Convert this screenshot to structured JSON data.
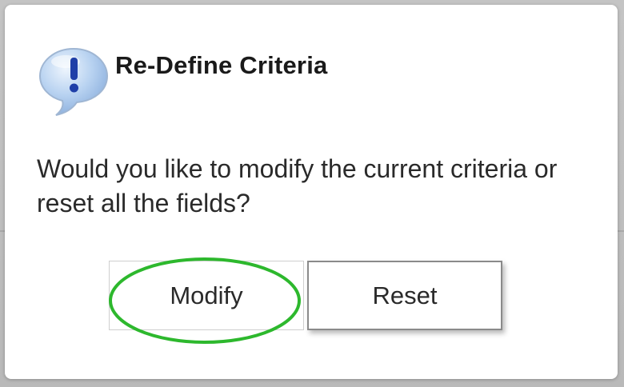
{
  "dialog": {
    "title": "Re-Define Criteria",
    "message": "Would you like to modify the current criteria or reset all the fields?",
    "icon": "exclamation-speech-bubble-icon"
  },
  "buttons": {
    "modify_label": "Modify",
    "reset_label": "Reset"
  },
  "colors": {
    "highlight": "#2db82d",
    "icon_bubble": "#a9c8ec",
    "icon_mark": "#1f3fa8"
  }
}
